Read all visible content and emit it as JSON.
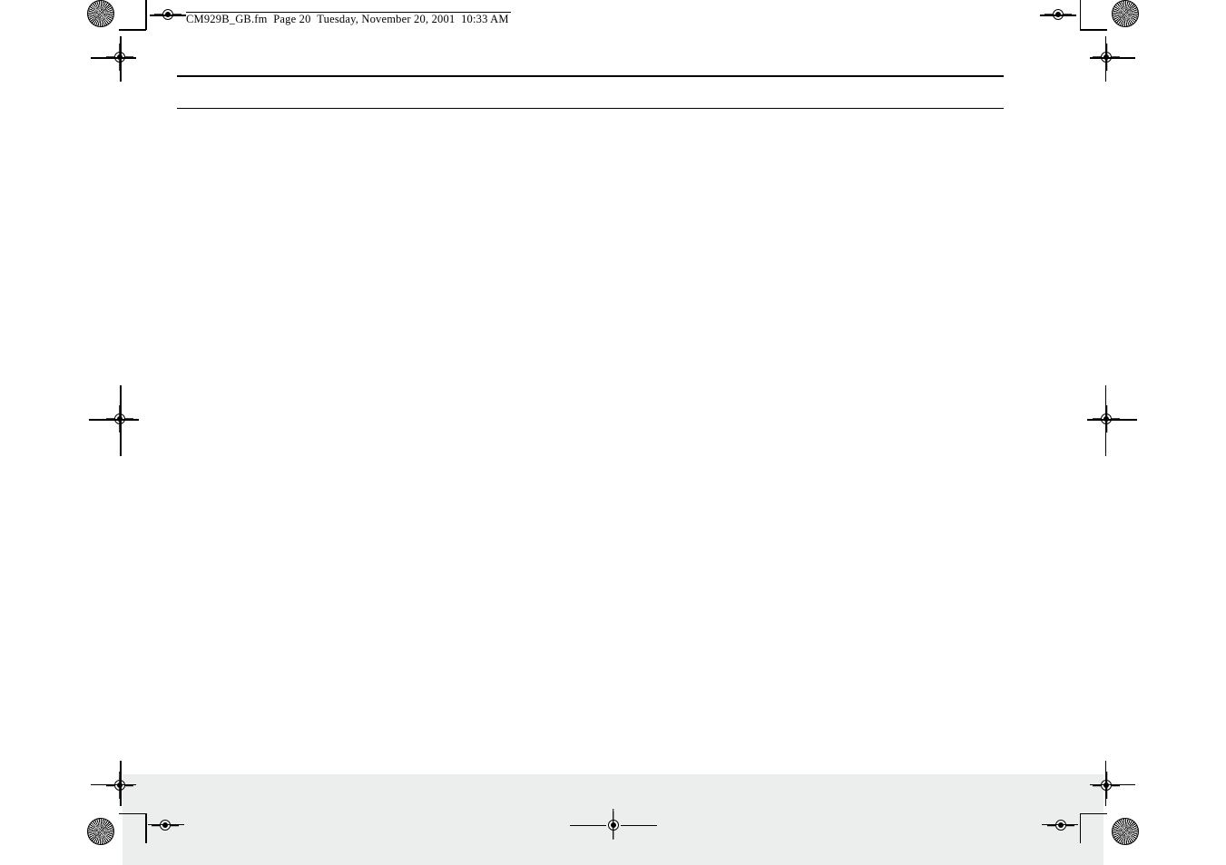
{
  "header": {
    "filename": "CM929B_GB.fm",
    "page_label": "Page 20",
    "date": "Tuesday, November 20, 2001",
    "time": "10:33 AM"
  }
}
